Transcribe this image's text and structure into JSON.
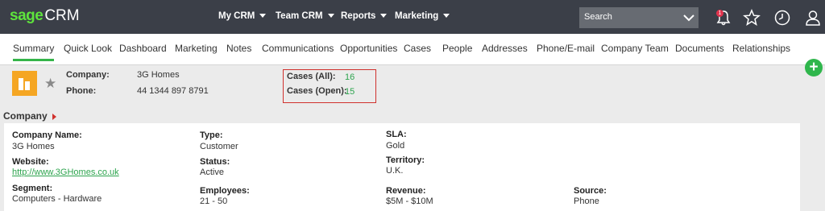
{
  "app": {
    "logo_sage": "sage",
    "logo_crm": "CRM"
  },
  "topnav": {
    "my_crm": "My CRM",
    "team_crm": "Team CRM",
    "reports": "Reports",
    "marketing": "Marketing"
  },
  "search": {
    "placeholder": "Search"
  },
  "notifications": {
    "badge_count": "1"
  },
  "tabs": [
    "Summary",
    "Quick Look",
    "Dashboard",
    "Marketing",
    "Notes",
    "Communications",
    "Opportunities",
    "Cases",
    "People",
    "Addresses",
    "Phone/E-mail",
    "Company Team",
    "Documents",
    "Relationships"
  ],
  "summary": {
    "company_label": "Company:",
    "company_value": "3G Homes",
    "phone_label": "Phone:",
    "phone_value": "44 1344 897 8791",
    "cases_all_label": "Cases (All):",
    "cases_all_value": "16",
    "cases_open_label": "Cases (Open):",
    "cases_open_value": "15"
  },
  "section": {
    "title": "Company"
  },
  "fields": {
    "company_name_label": "Company Name:",
    "company_name_value": "3G Homes",
    "type_label": "Type:",
    "type_value": "Customer",
    "sla_label": "SLA:",
    "sla_value": "Gold",
    "website_label": "Website:",
    "website_value": "http://www.3GHomes.co.uk",
    "status_label": "Status:",
    "status_value": "Active",
    "territory_label": "Territory:",
    "territory_value": "U.K.",
    "segment_label": "Segment:",
    "segment_value": "Computers - Hardware",
    "employees_label": "Employees:",
    "employees_value": "21 - 50",
    "revenue_label": "Revenue:",
    "revenue_value": "$5M - $10M",
    "source_label": "Source:",
    "source_value": "Phone"
  },
  "colors": {
    "topbar": "#3b3f48",
    "accent_green": "#35b54a",
    "highlight_red": "#d0312d",
    "company_icon": "#f5a623"
  }
}
